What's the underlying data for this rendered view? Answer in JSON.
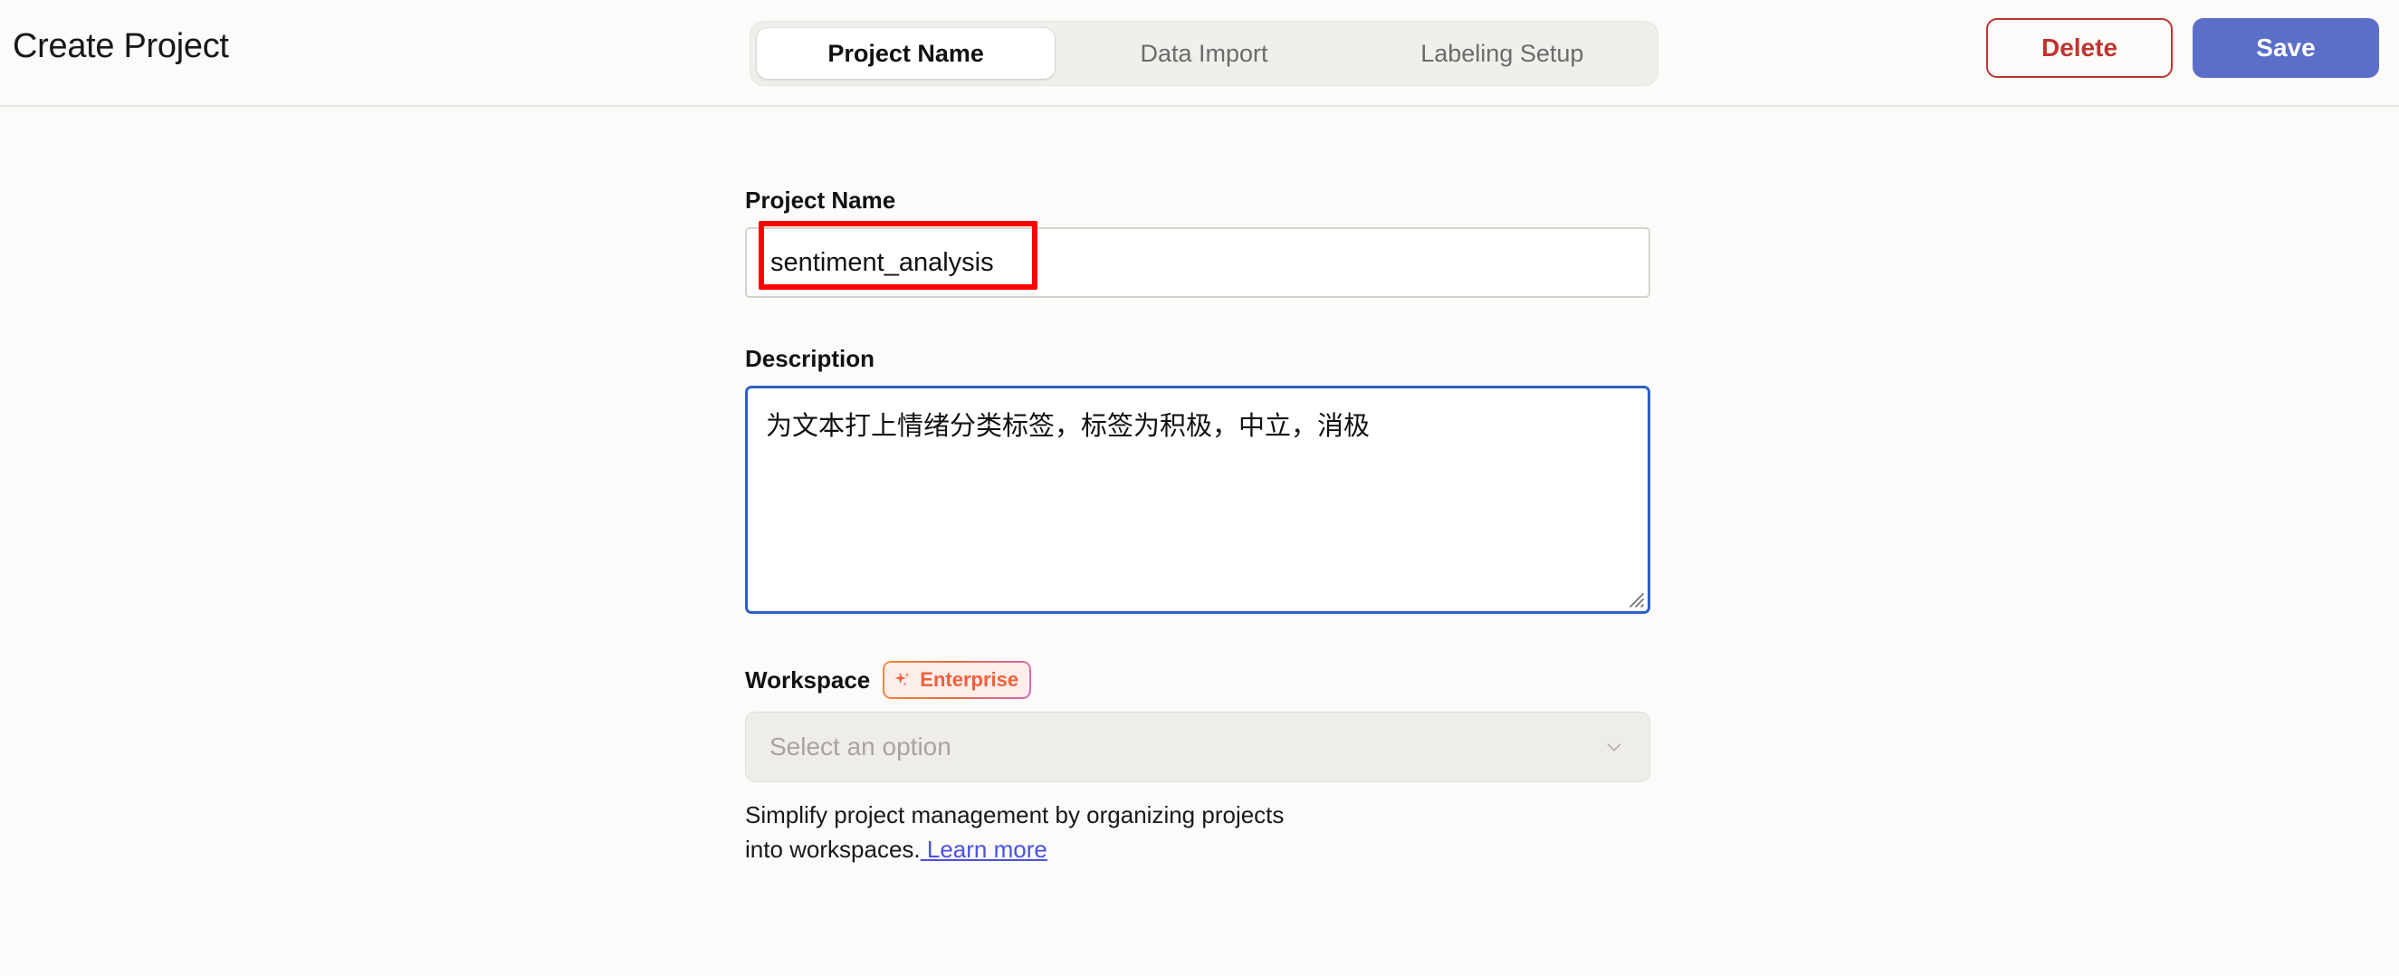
{
  "header": {
    "title": "Create Project",
    "tabs": [
      {
        "label": "Project Name",
        "active": true
      },
      {
        "label": "Data Import",
        "active": false
      },
      {
        "label": "Labeling Setup",
        "active": false
      }
    ],
    "delete_label": "Delete",
    "save_label": "Save"
  },
  "form": {
    "project_name": {
      "label": "Project Name",
      "value": "sentiment_analysis",
      "placeholder": ""
    },
    "description": {
      "label": "Description",
      "value": "为文本打上情绪分类标签，标签为积极，中立，消极",
      "placeholder": ""
    },
    "workspace": {
      "label": "Workspace",
      "badge": "Enterprise",
      "badge_icon": "sparkles-icon",
      "select_placeholder": "Select an option",
      "chevron_icon": "chevron-down-icon",
      "helper_text": "Simplify project management by organizing projects into workspaces.",
      "helper_link": " Learn more"
    }
  },
  "colors": {
    "background": "#fcfbf9",
    "accent_save": "#5b6fc8",
    "accent_delete": "#c0342f",
    "focus_border": "#2b62c4",
    "annotation": "#fe0000",
    "link": "#4a52e0",
    "badge_text": "#f2603a"
  }
}
